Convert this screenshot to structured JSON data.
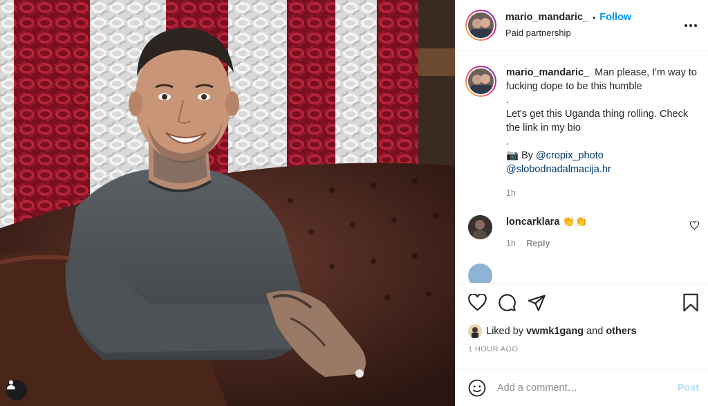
{
  "post": {
    "photo_alt": "photo",
    "user_tag_icon": "user-tag-icon"
  },
  "header": {
    "username": "mario_mandaric_",
    "separator": "•",
    "follow_label": "Follow",
    "subtitle": "Paid partnership",
    "more_icon": "more-options-icon"
  },
  "caption": {
    "username": "mario_mandaric_",
    "lines": [
      "Man please, I'm way to fucking dope to be this humble",
      ".",
      "Let's get this Uganda thing rolling. Check the link in my bio",
      "."
    ],
    "credit_prefix": "📷 By",
    "mention_1": "@cropix_photo",
    "mention_2": "@slobodnadalmacija.hr",
    "time": "1h"
  },
  "comments": [
    {
      "username": "loncarklara",
      "text": "👏👏",
      "time": "1h",
      "reply_label": "Reply"
    }
  ],
  "actions": {
    "icons": [
      "heart-icon",
      "comment-icon",
      "share-icon",
      "bookmark-icon"
    ],
    "liked_by_prefix": "Liked by",
    "liked_by_user": "vwmk1gang",
    "liked_by_and": "and",
    "liked_by_others": "others",
    "time_ago": "1 HOUR AGO"
  },
  "add_comment": {
    "placeholder": "Add a comment…",
    "post_label": "Post",
    "emoji_icon": "emoji-icon"
  },
  "colors": {
    "accent": "#0095f6",
    "link": "#00376b",
    "muted": "#8e8e8e",
    "post_disabled": "#b2dffc",
    "border": "#efefef"
  }
}
